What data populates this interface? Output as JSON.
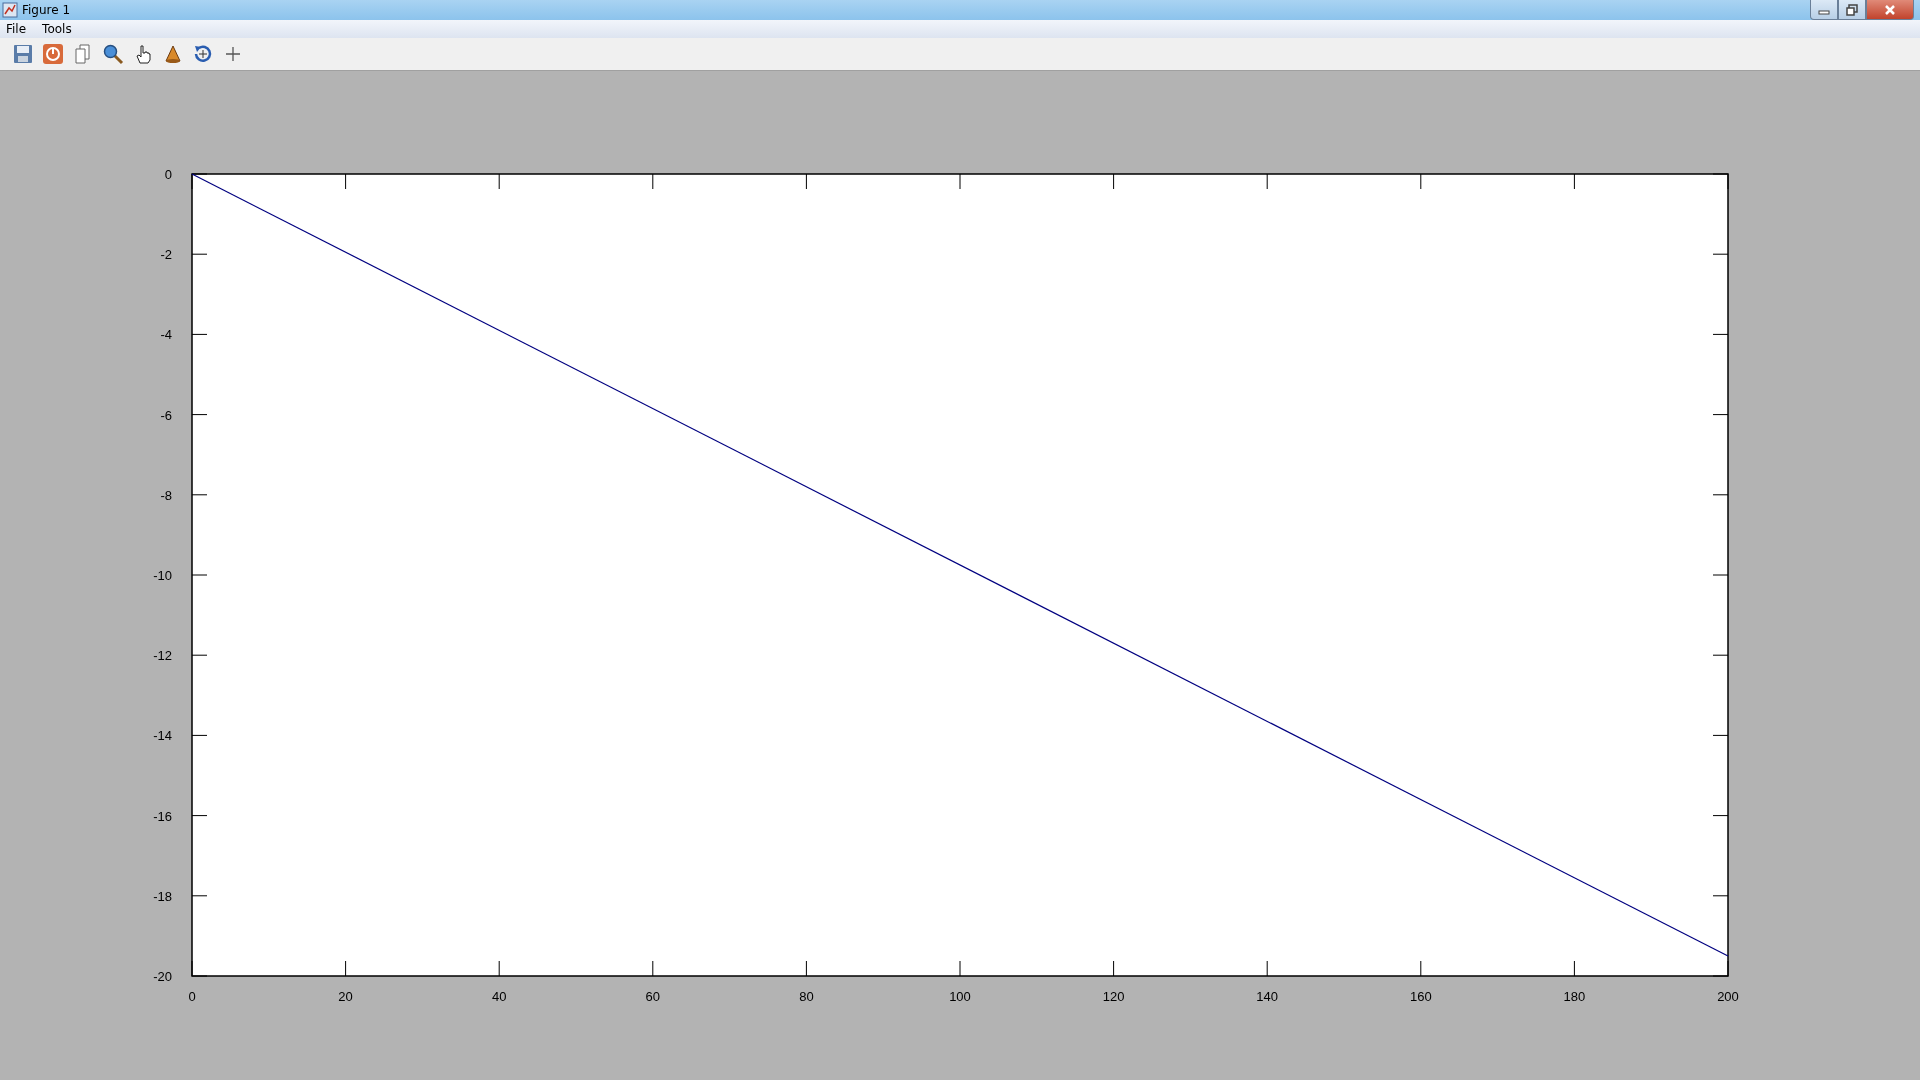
{
  "window": {
    "title": "Figure 1"
  },
  "menu": [
    {
      "label": "File"
    },
    {
      "label": "Tools"
    }
  ],
  "figure": {
    "chart_data": {
      "type": "line",
      "x": [
        0,
        200
      ],
      "series": [
        {
          "color": "#000080",
          "values": [
            0,
            -19.5
          ]
        }
      ],
      "xlim": [
        0,
        200
      ],
      "ylim": [
        -20,
        0
      ],
      "xticks": [
        0,
        20,
        40,
        60,
        80,
        100,
        120,
        140,
        160,
        180,
        200
      ],
      "yticks": [
        0,
        -2,
        -4,
        -6,
        -8,
        -10,
        -12,
        -14,
        -16,
        -18,
        -20
      ]
    }
  }
}
